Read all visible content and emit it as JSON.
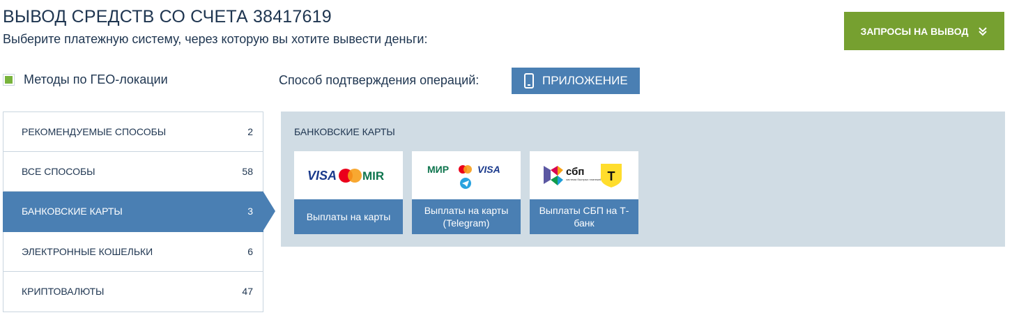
{
  "header": {
    "title": "ВЫВОД СРЕДСТВ СО СЧЕТА 38417619",
    "subtitle": "Выберите платежную систему, через которую вы хотите вывести деньги:",
    "requests_button": "ЗАПРОСЫ НА ВЫВОД"
  },
  "geo": {
    "label": "Методы по ГЕО-локации",
    "checked": true
  },
  "confirmation": {
    "label": "Способ подтверждения операций:",
    "button": "ПРИЛОЖЕНИЕ"
  },
  "categories": [
    {
      "label": "РЕКОМЕНДУЕМЫЕ СПОСОБЫ",
      "count": "2",
      "active": false
    },
    {
      "label": "ВСЕ СПОСОБЫ",
      "count": "58",
      "active": false
    },
    {
      "label": "БАНКОВСКИЕ КАРТЫ",
      "count": "3",
      "active": true
    },
    {
      "label": "ЭЛЕКТРОННЫЕ КОШЕЛЬКИ",
      "count": "6",
      "active": false
    },
    {
      "label": "КРИПТОВАЛЮТЫ",
      "count": "47",
      "active": false
    }
  ],
  "panel": {
    "title": "БАНКОВСКИЕ КАРТЫ",
    "methods": [
      {
        "label": "Выплаты на карты",
        "logo": "visa-mastercard-mir-logo",
        "logo_text": [
          "VISA",
          "MIR"
        ]
      },
      {
        "label": "Выплаты на карты (Telegram)",
        "logo": "mir-mastercard-visa-telegram-logo",
        "logo_text": [
          "МИР",
          "VISA"
        ]
      },
      {
        "label": "Выплаты СБП на Т-банк",
        "logo": "sbp-tbank-logo",
        "logo_text": [
          "сбп",
          "система быстрых платежей",
          "Т"
        ]
      }
    ]
  },
  "colors": {
    "accent_blue": "#4a7fb3",
    "green_button": "#76a030",
    "panel_bg": "#d0dce4",
    "text_dark": "#1e3550",
    "check_green": "#78b33c"
  }
}
